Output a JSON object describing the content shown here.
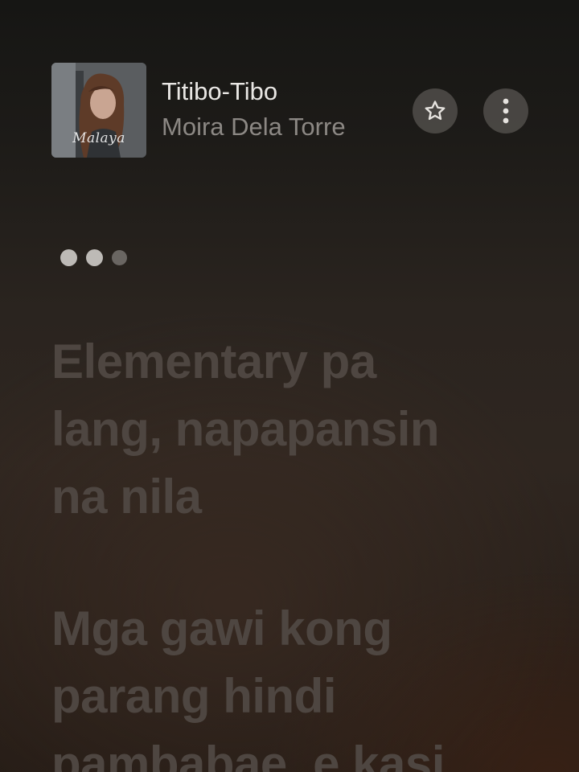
{
  "track": {
    "title": "Titibo-Tibo",
    "artist": "Moira Dela Torre",
    "artwork_text": "Malaya"
  },
  "icons": {
    "favorite": "star-icon",
    "more": "more-vertical-icon"
  },
  "lyrics": {
    "verse1": [
      "Elementary pa",
      "lang, napapansin",
      "na nila"
    ],
    "verse2": [
      "Mga gawi kong",
      "parang hindi",
      "pambabae, e kasi"
    ]
  },
  "colors": {
    "title": "#e9e7e4",
    "artist": "#8c8884",
    "lyric_inactive": "#4e4641",
    "button_bg": "#6e6a66"
  }
}
